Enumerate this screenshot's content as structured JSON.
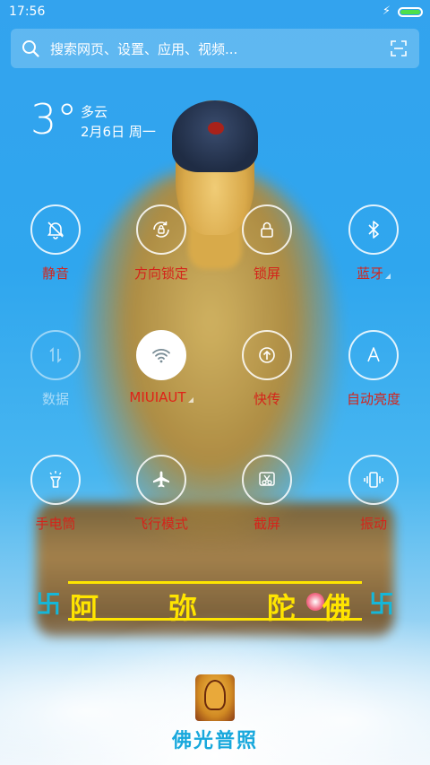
{
  "status_bar": {
    "time": "17:56",
    "charging_icon": "bolt-icon",
    "battery_color": "#4ee04a"
  },
  "search": {
    "placeholder": "搜索网页、设置、应用、视频...",
    "icon": "search-icon",
    "scan_icon": "scan-icon"
  },
  "weather": {
    "temperature": "3°",
    "condition": "多云",
    "date": "2月6日 周一"
  },
  "toggles": [
    {
      "label": "静音",
      "icon": "bell-off-icon",
      "state": "off"
    },
    {
      "label": "方向锁定",
      "icon": "rotation-lock-icon",
      "state": "off"
    },
    {
      "label": "锁屏",
      "icon": "lock-icon",
      "state": "off"
    },
    {
      "label": "蓝牙",
      "icon": "bluetooth-icon",
      "state": "off",
      "has_more": true
    },
    {
      "label": "数据",
      "icon": "mobile-data-icon",
      "state": "disabled"
    },
    {
      "label": "MIUIAUT",
      "icon": "wifi-icon",
      "state": "on",
      "has_more": true
    },
    {
      "label": "快传",
      "icon": "upload-icon",
      "state": "off"
    },
    {
      "label": "自动亮度",
      "icon": "auto-brightness-icon",
      "state": "off"
    },
    {
      "label": "手电筒",
      "icon": "flashlight-icon",
      "state": "off"
    },
    {
      "label": "飞行模式",
      "icon": "airplane-icon",
      "state": "off"
    },
    {
      "label": "截屏",
      "icon": "scissors-icon",
      "state": "off"
    },
    {
      "label": "振动",
      "icon": "vibrate-icon",
      "state": "off"
    }
  ],
  "banner": {
    "chars": [
      "阿",
      "弥",
      "陀",
      "佛"
    ],
    "symbol_left": "卐",
    "symbol_right": "卐",
    "text_color": "#ffe500",
    "symbol_color": "#15b7d9"
  },
  "widget": {
    "label": "佛光普照",
    "icon": "buddha-icon"
  },
  "colors": {
    "label_red": "#d4241b",
    "sky_blue": "#2fa6ee"
  }
}
